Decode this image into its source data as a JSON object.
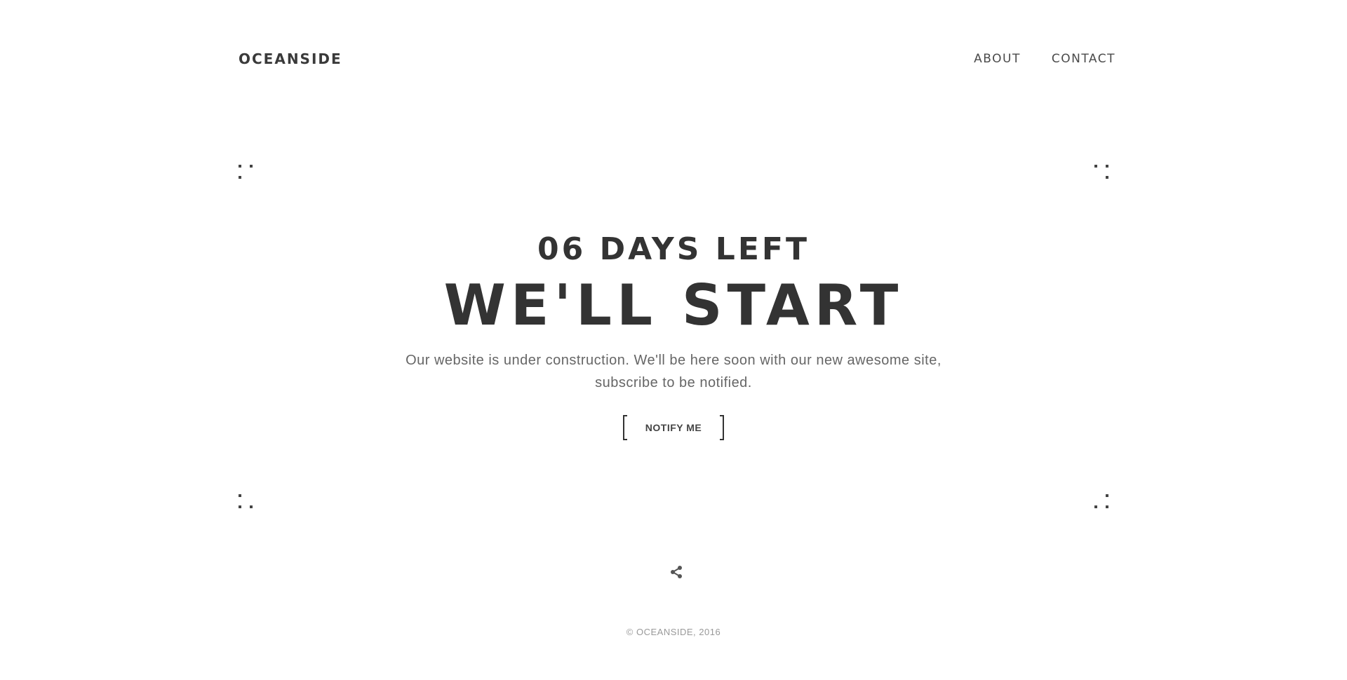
{
  "header": {
    "logo": "OCEANSIDE",
    "nav": [
      {
        "label": "ABOUT"
      },
      {
        "label": "CONTACT"
      }
    ]
  },
  "hero": {
    "days_left": "06 DAYS LEFT",
    "headline": "WE'LL START",
    "description": "Our website is under construction. We'll be here soon with our new awesome site, subscribe to be notified.",
    "notify_button": "NOTIFY ME"
  },
  "icons": {
    "share": "share-icon"
  },
  "footer": {
    "copyright": "© OCEANSIDE, 2016"
  },
  "colors": {
    "text_dark": "#333333",
    "text_muted": "#666666",
    "footer_text": "#999999",
    "background": "#ffffff"
  }
}
